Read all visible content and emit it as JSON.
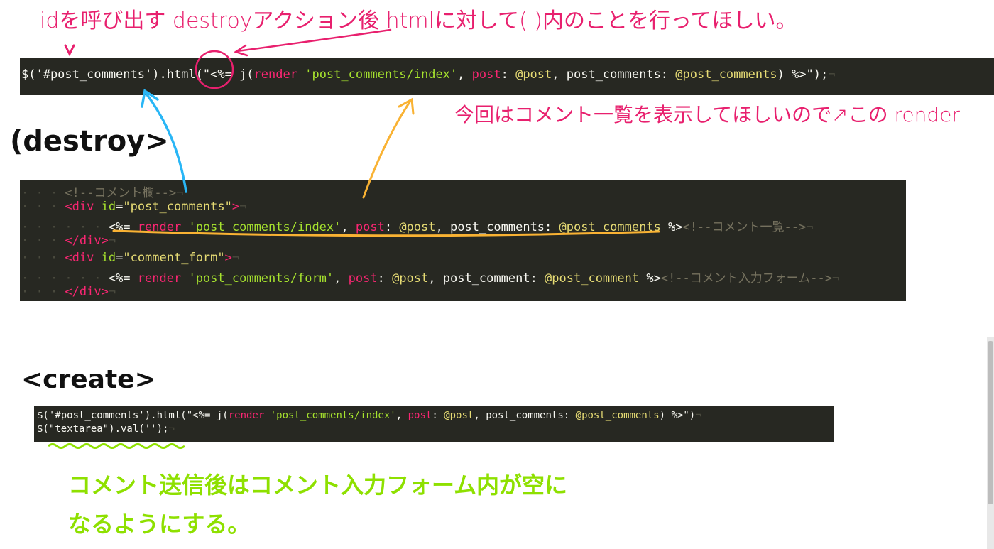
{
  "annotations": {
    "top_note": "idを呼び出す destroyアクション後 htmlに対して( )内のことを行ってほしい。",
    "right_note": "今回はコメント一覧を表示してほしいので↗この render",
    "destroy_label": "(destroy>",
    "create_label": "<create>",
    "green_note_1": "コメント送信後はコメント入力フォーム内が空に",
    "green_note_2": "なるようにする。"
  },
  "code_line_1": {
    "selector": "$('#post_comments').",
    "method": "html",
    "open": "(\"<%= j(",
    "render": "render",
    "path": "'post_comments/index'",
    "comma1": ", ",
    "post_key": "post",
    "colon1": ": ",
    "post_ivar": "@post",
    "comma2": ", ",
    "pc_key": "post_comments: ",
    "pc_ivar": "@post_comments",
    "close": ") %>\");",
    "eol": "¬"
  },
  "code_block_destroy": {
    "l1_guides": "· · · ",
    "l1_comment": "<!--コメント欄-->",
    "l2_guides": "· · · ",
    "l2_open": "<div ",
    "l2_attr": "id",
    "l2_eq": "=",
    "l2_val": "\"post_comments\"",
    "l2_end": ">",
    "l3_guides": "· · · · · · ",
    "l3_erb_open": "<%= ",
    "l3_render": "render",
    "l3_path": "'post_comments/index'",
    "l3_sep1": ", ",
    "l3_post_key": "post",
    "l3_colon": ": ",
    "l3_post_ivar": "@post",
    "l3_sep2": ", ",
    "l3_pc_key": "post_comments: ",
    "l3_pc_ivar": "@post_comments",
    "l3_erb_close": " %>",
    "l3_comment": "<!--コメント一覧-->",
    "l4_guides": "· · · ",
    "l4_close": "</div>",
    "l5_guides": "· · · ",
    "l5_open": "<div ",
    "l5_attr": "id",
    "l5_eq": "=",
    "l5_val": "\"comment_form\"",
    "l5_end": ">",
    "l6_guides": "· · · · · · ",
    "l6_erb_open": "<%= ",
    "l6_render": "render",
    "l6_path": "'post_comments/form'",
    "l6_sep1": ", ",
    "l6_post_key": "post",
    "l6_colon": ": ",
    "l6_post_ivar": "@post",
    "l6_sep2": ", ",
    "l6_pc_key": "post_comment: ",
    "l6_pc_ivar": "@post_comment",
    "l6_erb_close": " %>",
    "l6_comment": "<!--コメント入力フォーム-->",
    "l7_guides": "· · · ",
    "l7_close": "</div>",
    "eol": "¬"
  },
  "code_block_create": {
    "l1_selector": "$('#post_comments').html(\"<%= j(",
    "l1_render": "render",
    "l1_path": "'post_comments/index'",
    "l1_sep1": ", ",
    "l1_post_key": "post",
    "l1_colon": ": ",
    "l1_post_ivar": "@post",
    "l1_sep2": ", ",
    "l1_pc_key": "post_comments: ",
    "l1_pc_ivar": "@post_comments",
    "l1_close": ") %>\")",
    "l2_code": "$(\"textarea\").val('');",
    "eol": "¬"
  },
  "colors": {
    "editor_bg": "#272822",
    "annotation_pink": "#e8206e",
    "annotation_blue": "#29b6f6",
    "annotation_orange": "#f9b233",
    "annotation_green": "#8ee000"
  }
}
